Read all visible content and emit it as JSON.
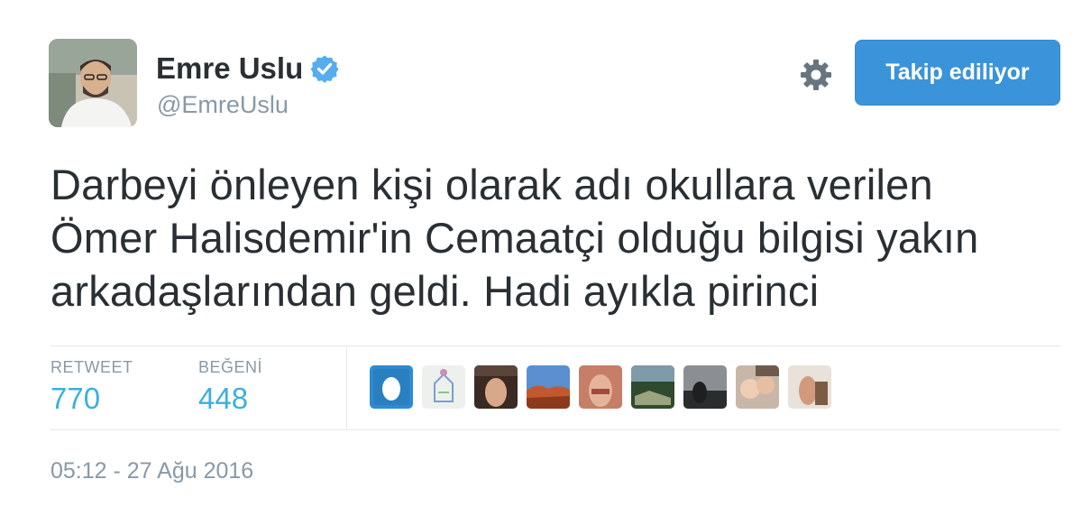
{
  "author": {
    "name": "Emre Uslu",
    "handle": "@EmreUslu",
    "verified_icon": "verified-badge-icon",
    "avatar_icon": "profile-photo"
  },
  "actions": {
    "settings_icon": "gear-icon",
    "follow_label": "Takip ediliyor",
    "follow_color": "#3b94d9"
  },
  "tweet": {
    "lines": [
      "Darbeyi önleyen kişi olarak adı okullara verilen",
      "Ömer Halisdemir'in Cemaatçi olduğu bilgisi yakın",
      "arkadaşlarından geldi. Hadi ayıkla pirinci"
    ]
  },
  "stats": {
    "retweets": {
      "label": "RETWEET",
      "value": "770"
    },
    "likes": {
      "label": "BEĞENİ",
      "value": "448"
    },
    "accent_color": "#3bb0dd"
  },
  "liked_by_avatars": [
    "default-egg-avatar",
    "drawing-avatar",
    "photo-avatar",
    "landscape-avatar",
    "photo-avatar",
    "scenery-avatar",
    "dark-photo-avatar",
    "children-avatar",
    "photo-avatar"
  ],
  "timestamp": "05:12 - 27 Ağu 2016"
}
